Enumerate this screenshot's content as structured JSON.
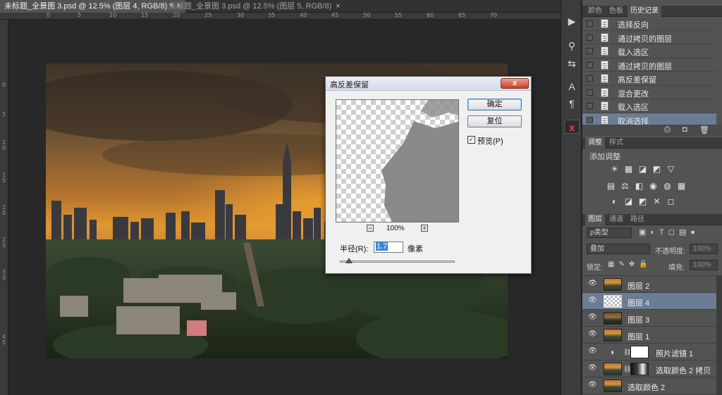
{
  "document_tabs": [
    {
      "label": "未标题_全景图 3.psd @ 12.5% (图层 4, RGB/8) *",
      "active": true
    },
    {
      "label": "未标题_全景图 3.psd @ 12.5% (图层 5, RGB/8)",
      "active": false
    }
  ],
  "ruler_top": [
    "0",
    "5",
    "10",
    "15",
    "20",
    "25",
    "30",
    "35",
    "40",
    "45",
    "50",
    "55",
    "60",
    "65",
    "70"
  ],
  "ruler_left": [
    "0",
    "5",
    "1",
    "0",
    "1",
    "5",
    "2",
    "0",
    "2",
    "5",
    "3",
    "0",
    "4",
    "5"
  ],
  "dialog": {
    "title": "高反差保留",
    "ok_label": "确定",
    "reset_label": "复位",
    "preview_label": "预览(P)",
    "preview_checked": true,
    "zoom_out": "−",
    "zoom_in": "+",
    "zoom_level": "100%",
    "radius_label": "半径(R):",
    "radius_value": "1.7",
    "radius_unit": "像素",
    "close": "x"
  },
  "tools": [
    "play-icon",
    "brush-settings-icon",
    "tool-presets-icon",
    "character-icon",
    "paragraph-icon",
    "close-x-icon"
  ],
  "history_panel": {
    "tabs": [
      "颜色",
      "色板",
      "历史记录"
    ],
    "active_tab": "历史记录",
    "items": [
      "选择反向",
      "通过拷贝的图层",
      "载入选区",
      "通过拷贝的图层",
      "高反差保留",
      "混合更改",
      "载入选区",
      "取消选择"
    ],
    "active_index": 7
  },
  "adjustments_panel": {
    "tabs": [
      "调整",
      "样式"
    ],
    "active_tab": "调整",
    "heading": "添加调整",
    "icons": [
      "☀",
      "▦",
      "◪",
      "◩",
      "▽",
      "▤",
      "⚖",
      "◧",
      "◉",
      "◍",
      "▦",
      "◐",
      "◪",
      "◩",
      "✕",
      "◻"
    ]
  },
  "layers_panel": {
    "tabs": [
      "图层",
      "通道",
      "路径"
    ],
    "active_tab": "图层",
    "filter_label": "ρ类型",
    "blend_mode": "叠加",
    "opacity_label": "不透明度:",
    "opacity_value": "100%",
    "lock_label": "锁定:",
    "fill_label": "填充:",
    "fill_value": "100%",
    "layers": [
      {
        "name": "图层 2",
        "thumb": "photo",
        "active": false
      },
      {
        "name": "图层 4",
        "thumb": "checker",
        "active": true
      },
      {
        "name": "图层 3",
        "thumb": "photo-dark",
        "active": false
      },
      {
        "name": "图层 1",
        "thumb": "photo",
        "active": false
      },
      {
        "name": "照片滤镜 1",
        "thumb": "adjust",
        "active": false
      },
      {
        "name": "选取颜色 2 拷贝",
        "thumb": "photo-mask",
        "active": false
      },
      {
        "name": "选取颜色 2",
        "thumb": "photo",
        "active": false
      }
    ]
  },
  "colors": {
    "accent_selection": "#6a7d94",
    "panel_bg": "#535353"
  }
}
